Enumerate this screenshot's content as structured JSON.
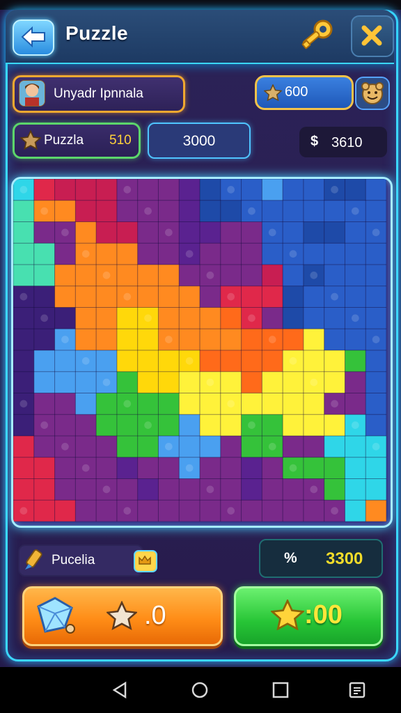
{
  "header": {
    "title": "Puzzle",
    "back_icon": "arrow-left-icon",
    "key_icon": "key-icon",
    "close_icon": "close-icon"
  },
  "player": {
    "name": "Unyadr Ipnnala",
    "stars": "600",
    "emote_icon": "smiley-icon"
  },
  "level": {
    "label": "Puzzla",
    "number": "510",
    "score": "3000",
    "coins_symbol": "$",
    "coins": "3610"
  },
  "footer": {
    "hint_label": "Pucelia",
    "percent_symbol": "%",
    "percent_value": "3300",
    "orange_button_value": ".0",
    "green_button_value": ":00"
  },
  "nav": [
    "back-triangle-icon",
    "home-circle-icon",
    "recents-square-icon",
    "menu-icon"
  ],
  "colors": {
    "accent_cyan": "#3bd8ff",
    "orange_button": "#ff8d17",
    "green_button": "#27c536",
    "gold": "#ffd23a"
  }
}
